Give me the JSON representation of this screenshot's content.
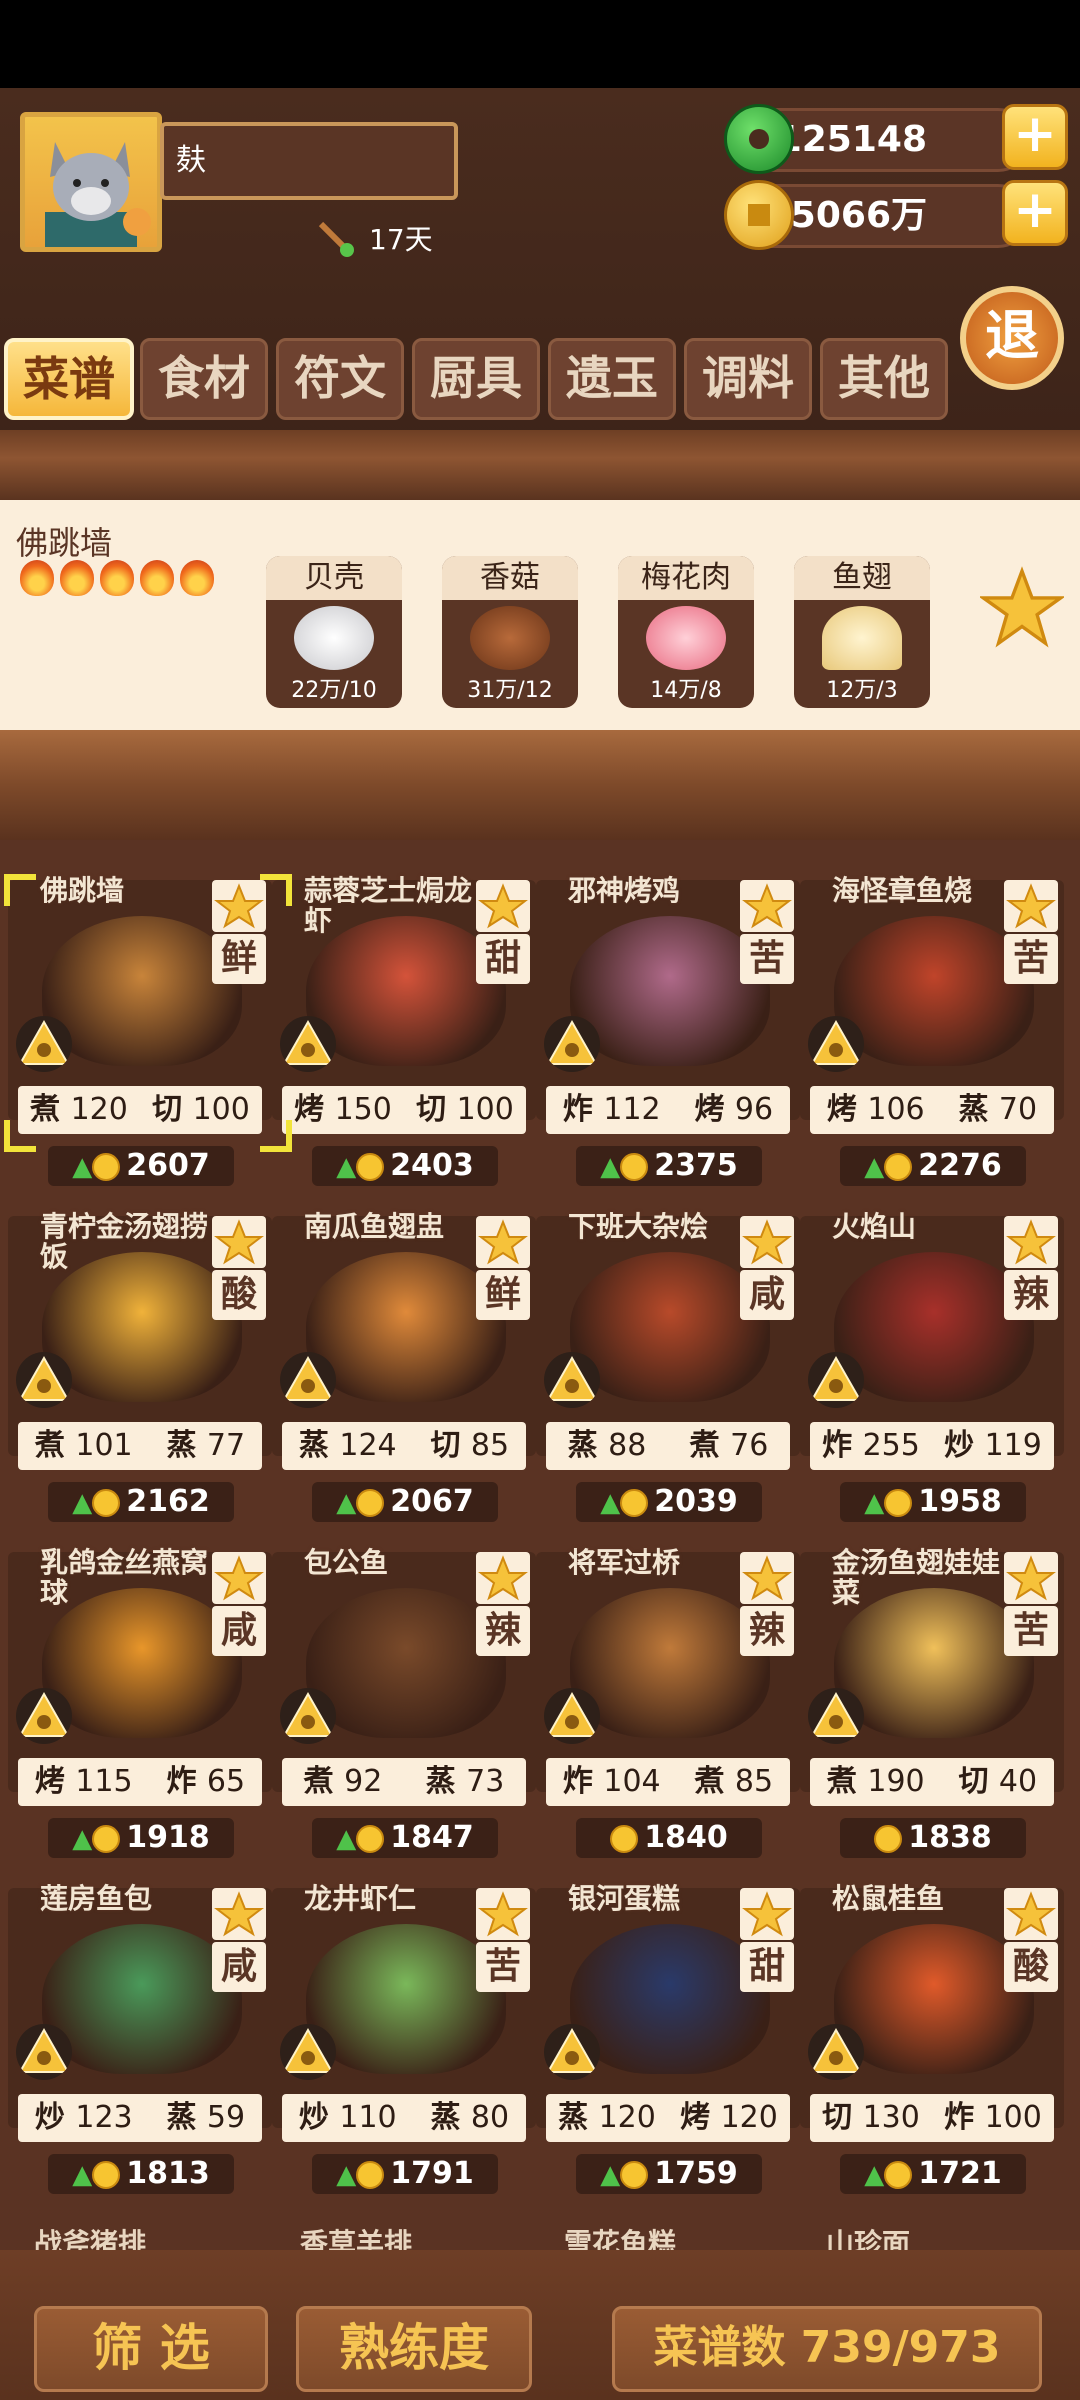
{
  "player": {
    "name": "麸",
    "days": "17天"
  },
  "currency": {
    "jade": "125148",
    "coins": "35066万"
  },
  "exit_label": "退",
  "tabs": [
    "菜谱",
    "食材",
    "符文",
    "厨具",
    "遗玉",
    "调料",
    "其他"
  ],
  "detail": {
    "name": "佛跳墙",
    "ingredients": [
      {
        "label": "贝壳",
        "count": "22万/10"
      },
      {
        "label": "香菇",
        "count": "31万/12"
      },
      {
        "label": "梅花肉",
        "count": "14万/8"
      },
      {
        "label": "鱼翅",
        "count": "12万/3"
      }
    ]
  },
  "recipes": [
    {
      "name": "佛跳墙",
      "taste": "鲜",
      "m1": "煮",
      "v1": "120",
      "m2": "切",
      "v2": "100",
      "price": "2607",
      "up": true,
      "color": "#c8843a"
    },
    {
      "name": "蒜蓉芝士焗龙虾",
      "taste": "甜",
      "m1": "烤",
      "v1": "150",
      "m2": "切",
      "v2": "100",
      "price": "2403",
      "up": true,
      "color": "#d4533a"
    },
    {
      "name": "邪神烤鸡",
      "taste": "苦",
      "m1": "炸",
      "v1": "112",
      "m2": "烤",
      "v2": "96",
      "price": "2375",
      "up": true,
      "color": "#b06a8a"
    },
    {
      "name": "海怪章鱼烧",
      "taste": "苦",
      "m1": "烤",
      "v1": "106",
      "m2": "蒸",
      "v2": "70",
      "price": "2276",
      "up": true,
      "color": "#c0442a"
    },
    {
      "name": "青柠金汤翅捞饭",
      "taste": "酸",
      "m1": "煮",
      "v1": "101",
      "m2": "蒸",
      "v2": "77",
      "price": "2162",
      "up": true,
      "color": "#f0b23a"
    },
    {
      "name": "南瓜鱼翅盅",
      "taste": "鲜",
      "m1": "蒸",
      "v1": "124",
      "m2": "切",
      "v2": "85",
      "price": "2067",
      "up": true,
      "color": "#e08a3a"
    },
    {
      "name": "下班大杂烩",
      "taste": "咸",
      "m1": "蒸",
      "v1": "88",
      "m2": "煮",
      "v2": "76",
      "price": "2039",
      "up": true,
      "color": "#b84a2a"
    },
    {
      "name": "火焰山",
      "taste": "辣",
      "m1": "炸",
      "v1": "255",
      "m2": "炒",
      "v2": "119",
      "price": "1958",
      "up": true,
      "color": "#a8302a"
    },
    {
      "name": "乳鸽金丝燕窝球",
      "taste": "咸",
      "m1": "烤",
      "v1": "115",
      "m2": "炸",
      "v2": "65",
      "price": "1918",
      "up": true,
      "color": "#e8962a"
    },
    {
      "name": "包公鱼",
      "taste": "辣",
      "m1": "煮",
      "v1": "92",
      "m2": "蒸",
      "v2": "73",
      "price": "1847",
      "up": true,
      "color": "#7a4a2a"
    },
    {
      "name": "将军过桥",
      "taste": "辣",
      "m1": "炸",
      "v1": "104",
      "m2": "煮",
      "v2": "85",
      "price": "1840",
      "up": false,
      "color": "#c07a3a"
    },
    {
      "name": "金汤鱼翅娃娃菜",
      "taste": "苦",
      "m1": "煮",
      "v1": "190",
      "m2": "切",
      "v2": "40",
      "price": "1838",
      "up": false,
      "color": "#f0c05a"
    },
    {
      "name": "莲房鱼包",
      "taste": "咸",
      "m1": "炒",
      "v1": "123",
      "m2": "蒸",
      "v2": "59",
      "price": "1813",
      "up": true,
      "color": "#4a9a5a"
    },
    {
      "name": "龙井虾仁",
      "taste": "苦",
      "m1": "炒",
      "v1": "110",
      "m2": "蒸",
      "v2": "80",
      "price": "1791",
      "up": true,
      "color": "#7ab85a"
    },
    {
      "name": "银河蛋糕",
      "taste": "甜",
      "m1": "蒸",
      "v1": "120",
      "m2": "烤",
      "v2": "120",
      "price": "1759",
      "up": true,
      "color": "#2a3a6a"
    },
    {
      "name": "松鼠桂鱼",
      "taste": "酸",
      "m1": "切",
      "v1": "130",
      "m2": "炸",
      "v2": "100",
      "price": "1721",
      "up": true,
      "color": "#e05a2a"
    }
  ],
  "next_row": [
    "战斧猪排",
    "香草羊排",
    "雪花鱼糕",
    "山珍面"
  ],
  "bottom": {
    "filter": "筛 选",
    "mastery": "熟练度",
    "count": "菜谱数 739/973"
  }
}
